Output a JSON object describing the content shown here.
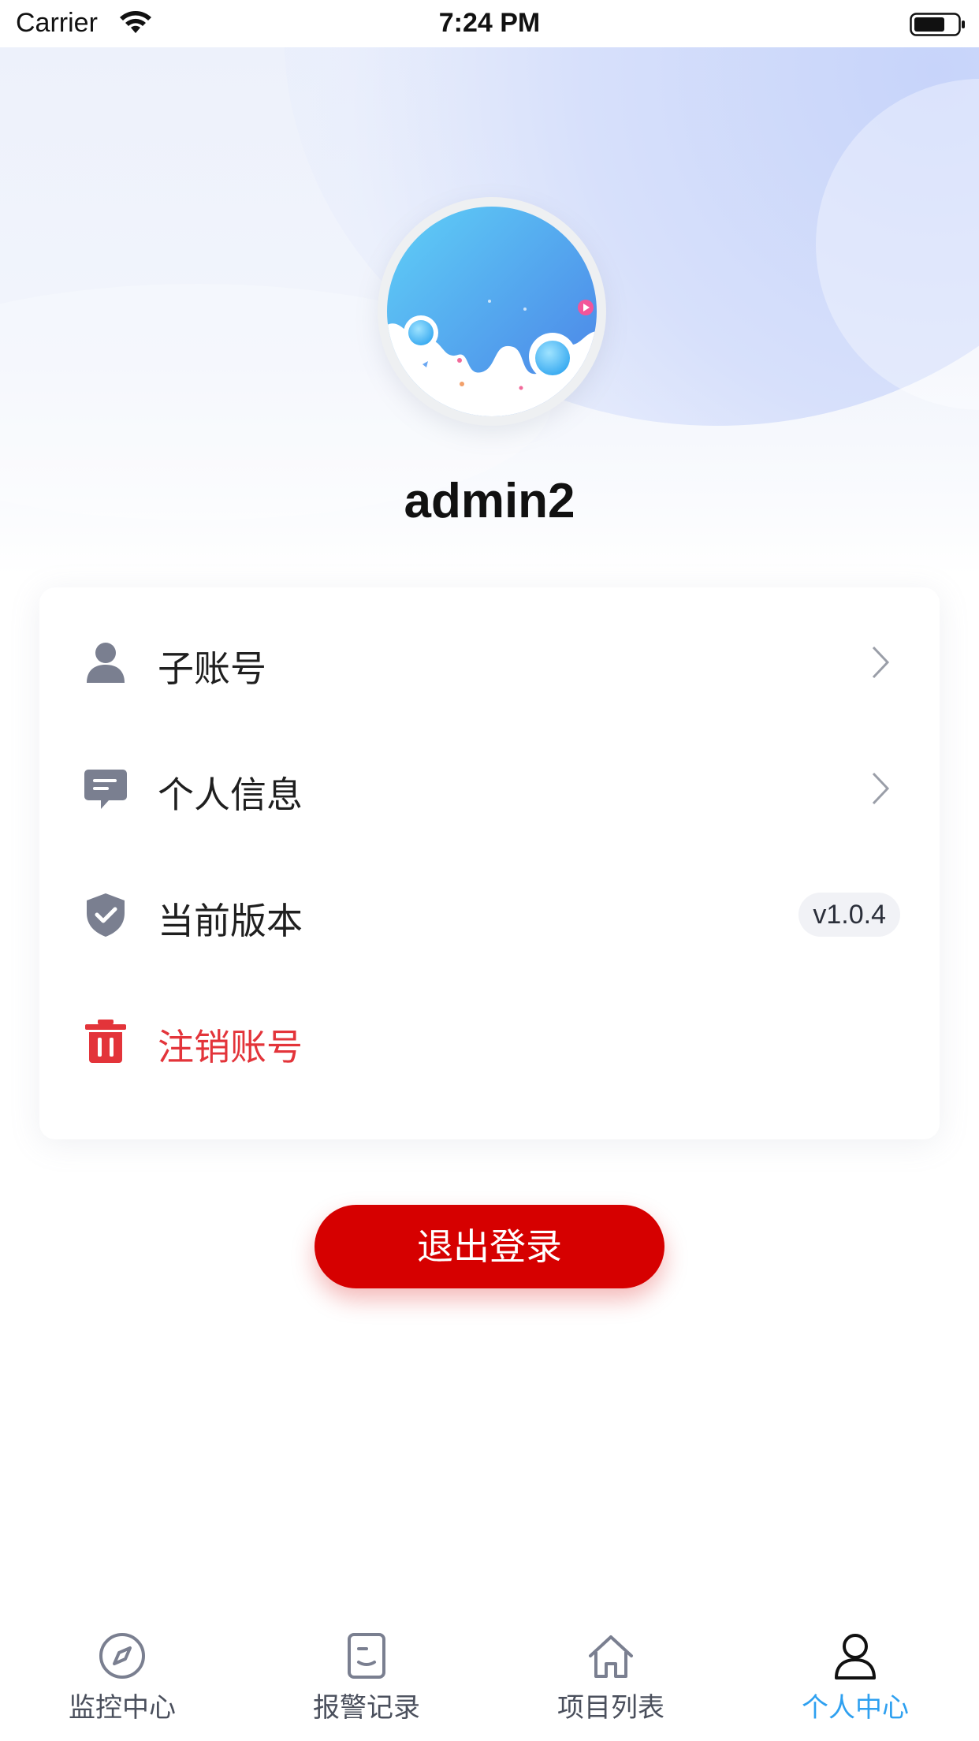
{
  "status_bar": {
    "carrier": "Carrier",
    "time": "7:24 PM"
  },
  "profile": {
    "username": "admin2"
  },
  "menu": {
    "items": [
      {
        "label": "子账号",
        "icon": "person-icon"
      },
      {
        "label": "个人信息",
        "icon": "message-icon"
      },
      {
        "label": "当前版本",
        "icon": "shield-check-icon",
        "value": "v1.0.4"
      },
      {
        "label": "注销账号",
        "icon": "trash-icon",
        "danger_color": "#e3343a"
      }
    ]
  },
  "logout": {
    "label": "退出登录",
    "color": "#d60000"
  },
  "tabs": [
    {
      "label": "监控中心",
      "icon": "compass-icon"
    },
    {
      "label": "报警记录",
      "icon": "document-icon"
    },
    {
      "label": "项目列表",
      "icon": "home-icon"
    },
    {
      "label": "个人中心",
      "icon": "user-icon",
      "active": true,
      "active_color": "#2ea0f0"
    }
  ]
}
